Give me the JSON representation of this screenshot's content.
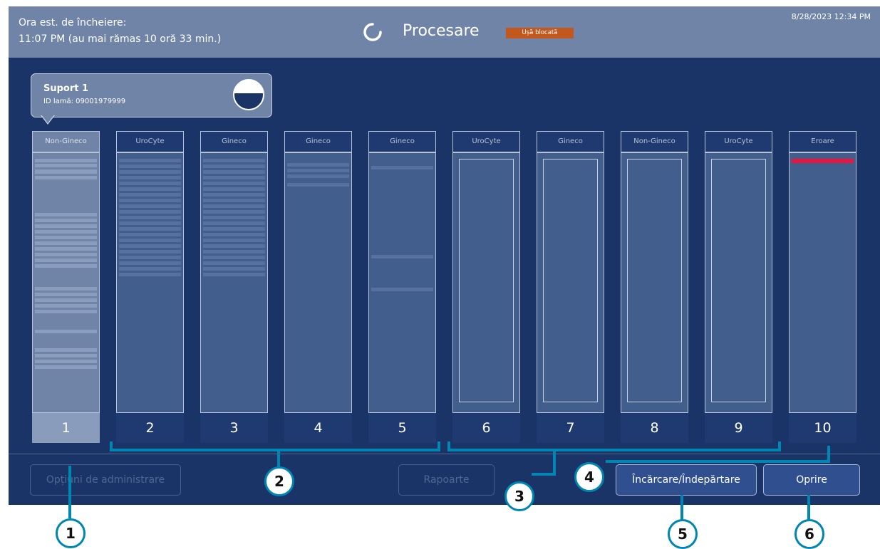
{
  "header": {
    "eta_label": "Ora est. de încheiere:",
    "eta_value": "11:07 PM (au mai rămas 10 oră 33 min.)",
    "status_title": "Procesare",
    "door_badge": "Ușă blocată",
    "datetime": "8/28/2023 12:34 PM"
  },
  "tooltip": {
    "title": "Suport 1",
    "slide_id": "ID lamă: 09001979999"
  },
  "racks": [
    {
      "number": "1",
      "label": "Non-Gineco",
      "selected": true
    },
    {
      "number": "2",
      "label": "UroCyte"
    },
    {
      "number": "3",
      "label": "Gineco"
    },
    {
      "number": "4",
      "label": "Gineco"
    },
    {
      "number": "5",
      "label": "Gineco"
    },
    {
      "number": "6",
      "label": "UroCyte"
    },
    {
      "number": "7",
      "label": "Gineco"
    },
    {
      "number": "8",
      "label": "Non-Gineco"
    },
    {
      "number": "9",
      "label": "UroCyte"
    },
    {
      "number": "10",
      "label": "Eroare"
    }
  ],
  "buttons": {
    "admin": "Opțiuni de administrare",
    "reports": "Rapoarte",
    "load": "Încărcare/Îndepărtare",
    "stop": "Oprire"
  },
  "callouts": [
    "1",
    "2",
    "3",
    "4",
    "5",
    "6"
  ],
  "colors": {
    "background": "#1b3468",
    "header": "#6f84a6",
    "door_badge": "#c2581e",
    "error_bar": "#e8163e",
    "callout": "#0086b2"
  }
}
